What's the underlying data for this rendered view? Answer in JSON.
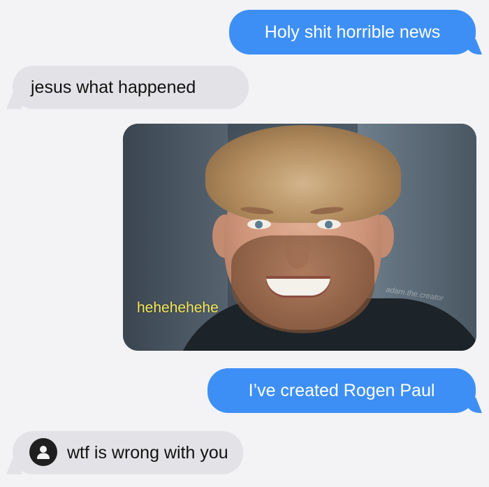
{
  "messages": {
    "m1": "Holy shit horrible news",
    "m2": "jesus what happened",
    "m3": "I’ve created Rogen Paul",
    "m4": "wtf is wrong with you"
  },
  "photo": {
    "caption": "hehehehehe",
    "watermark": "adam.the.creator"
  },
  "colors": {
    "sent_bubble": "#3d8ff5",
    "received_bubble": "#e3e3e7",
    "background": "#f3f3f5",
    "caption": "#f4e85a"
  },
  "icons": {
    "avatar": "person-silhouette-icon"
  }
}
